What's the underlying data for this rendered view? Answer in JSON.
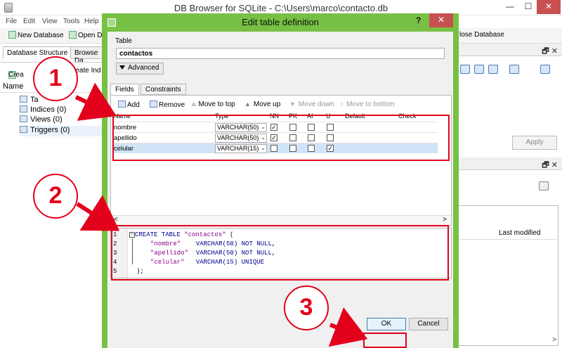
{
  "main_window": {
    "title": "DB Browser for SQLite - C:\\Users\\marco\\contacto.db",
    "controls": {
      "minimize": "—",
      "maximize": "☐",
      "close": "✕"
    },
    "menu": [
      "File",
      "Edit",
      "View",
      "Tools",
      "Help"
    ],
    "toolbar": {
      "new_database": "New Database",
      "open_database": "Open Da",
      "close_database": "lose Database"
    },
    "left_tabs": [
      "Database Structure",
      "Browse Da"
    ],
    "left_toolbar": {
      "create_table": "Crea",
      "create_index": "reate Ind"
    },
    "tree": {
      "header": "Name",
      "nodes": [
        {
          "label": "Ta"
        },
        {
          "label": "Indices (0)"
        },
        {
          "label": "Views (0)"
        },
        {
          "label": "Triggers (0)"
        }
      ]
    },
    "right_pane": {
      "dock_controls": "🗗 ✕",
      "apply_label": "Apply",
      "last_modified_header": "Last modified",
      "scroll_right": ">"
    }
  },
  "dialog": {
    "title": "Edit table definition",
    "help": "?",
    "close": "✕",
    "table_label": "Table",
    "table_name": "contactos",
    "advanced_label": "Advanced",
    "tabs": [
      "Fields",
      "Constraints"
    ],
    "field_tools": {
      "add": "Add",
      "remove": "Remove",
      "move_top": "Move to top",
      "move_up": "Move up",
      "move_down": "Move down",
      "move_bottom": "Move to bottom"
    },
    "grid": {
      "columns": [
        "Name",
        "Type",
        "NN",
        "PK",
        "AI",
        "U",
        "Default",
        "Check"
      ],
      "rows": [
        {
          "name": "nombre",
          "type": "VARCHAR(50)",
          "nn": true,
          "pk": false,
          "ai": false,
          "u": false
        },
        {
          "name": "apellido",
          "type": "VARCHAR(50)",
          "nn": true,
          "pk": false,
          "ai": false,
          "u": false
        },
        {
          "name": "celular",
          "type": "VARCHAR(15)",
          "nn": false,
          "pk": false,
          "ai": false,
          "u": true
        }
      ],
      "scroll_left": "<",
      "scroll_right": ">"
    },
    "sql": {
      "line_numbers": [
        "1",
        "2",
        "3",
        "4",
        "5"
      ],
      "line1_kw": "CREATE TABLE",
      "line1_name": "\"contactos\"",
      "line1_tail": " (",
      "l2_col": "\"nombre\"",
      "l2_type": "VARCHAR(50)",
      "l2_c": "NOT NULL",
      "l2_end": ",",
      "l3_col": "\"apellido\"",
      "l3_type": "VARCHAR(50)",
      "l3_c": "NOT NULL",
      "l3_end": ",",
      "l4_col": "\"celular\"",
      "l4_type": "VARCHAR(15)",
      "l4_c": "UNIQUE",
      "l5": ");"
    },
    "ok_label": "OK",
    "cancel_label": "Cancel"
  },
  "annotations": {
    "badges": [
      "1",
      "2",
      "3"
    ],
    "color": "#e3001b"
  },
  "colors": {
    "dialog_frame": "#77c044",
    "selected_row": "#cfe4f7",
    "keyword": "#00008b",
    "string": "#8b008b"
  }
}
